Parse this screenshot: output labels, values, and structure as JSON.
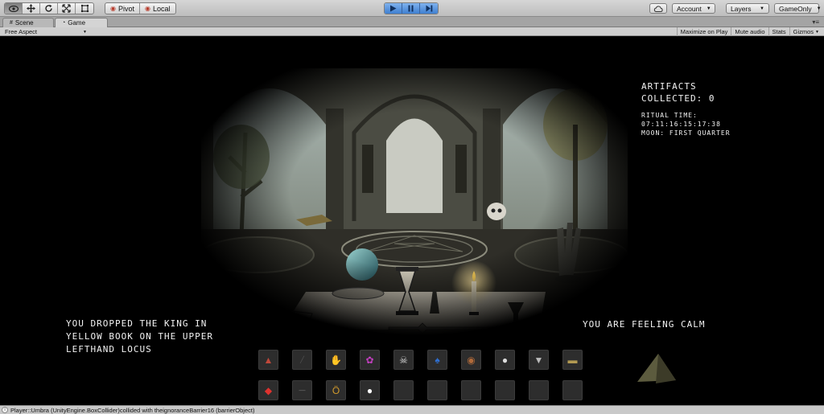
{
  "toolbar": {
    "transform_tools": [
      "hand-icon",
      "move-icon",
      "rotate-icon",
      "scale-icon",
      "rect-icon"
    ],
    "pivot_label": "Pivot",
    "local_label": "Local",
    "play_controls": [
      "play-icon",
      "pause-icon",
      "step-icon"
    ],
    "account_label": "Account",
    "layers_label": "Layers",
    "layout_label": "GameOnly"
  },
  "tabs": [
    {
      "label": "Scene",
      "icon": "grid-icon"
    },
    {
      "label": "Game",
      "icon": "pacman-icon"
    }
  ],
  "gamebar": {
    "aspect": "Free Aspect",
    "buttons": [
      "Maximize on Play",
      "Mute audio",
      "Stats",
      "Gizmos"
    ]
  },
  "hud": {
    "artifacts_line1": "Artifacts",
    "artifacts_line2": "Collected:  0",
    "ritual_time_label": "Ritual Time:",
    "ritual_time_value": "07:11:16:15:17:38",
    "moon": "Moon: First Quarter",
    "message": "You dropped the King in Yellow Book on the Upper Lefthand Locus",
    "mood": "You are feeling calm"
  },
  "inventory": {
    "row1": [
      "potion-icon",
      "empty",
      "hand-icon",
      "flower-icon",
      "skull-icon",
      "blue-flame-icon",
      "amulet-icon",
      "mask-icon",
      "goblet-icon",
      "book-icon"
    ],
    "row2": [
      "crystal-icon",
      "dagger-icon",
      "necklace-icon",
      "orb-icon",
      "empty",
      "empty",
      "empty",
      "empty",
      "empty",
      "empty"
    ]
  },
  "status": {
    "message": "Player::Umbra (UnityEngine.BoxCollider)collided with theignoranceBarrier16 (barrierObject)"
  }
}
